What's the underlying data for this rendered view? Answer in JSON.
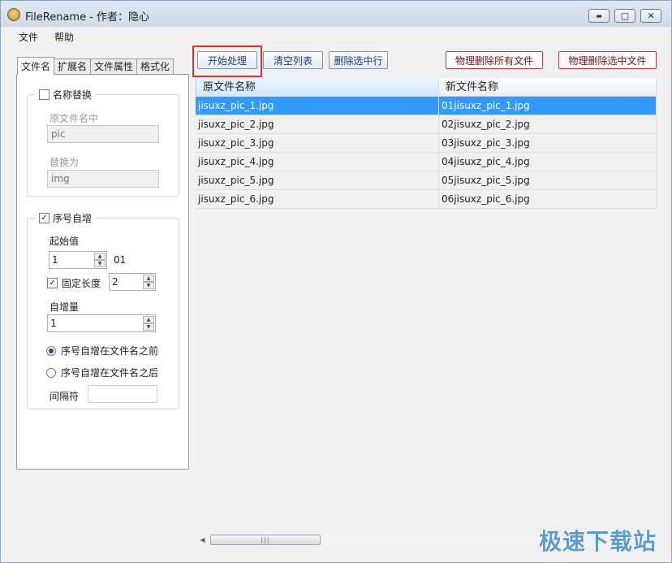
{
  "window": {
    "title": "FileRename - 作者：隐心"
  },
  "window_controls": {
    "minimize": "▬",
    "maximize": "▢",
    "close": "✕"
  },
  "menu": {
    "items": [
      "文件",
      "帮助"
    ]
  },
  "tabs": [
    "文件名",
    "扩展名",
    "文件属性",
    "格式化"
  ],
  "name_replace": {
    "label": "名称替换",
    "checked": false,
    "find_label": "原文件名中",
    "find_value": "pic",
    "replace_label": "替换为",
    "replace_value": "img"
  },
  "sequence": {
    "label": "序号自增",
    "checked": true,
    "check_mark": "✓",
    "start_label": "起始值",
    "start_value": "1",
    "preview": "01",
    "fixed_length_label": "固定长度",
    "fixed_length_checked": true,
    "fixed_length_value": "2",
    "increment_label": "自增量",
    "increment_value": "1",
    "before_label": "序号自增在文件名之前",
    "after_label": "序号自增在文件名之后",
    "position": "before",
    "separator_label": "间隔符",
    "separator_value": ""
  },
  "toolbar": {
    "start": "开始处理",
    "clear": "清空列表",
    "delete_selected_row": "删除选中行",
    "delete_all_files": "物理删除所有文件",
    "delete_selected_files": "物理删除选中文件"
  },
  "grid": {
    "columns": [
      "原文件名称",
      "新文件名称"
    ],
    "rows": [
      [
        "jisuxz_pic_1.jpg",
        "01jisuxz_pic_1.jpg"
      ],
      [
        "jisuxz_pic_2.jpg",
        "02jisuxz_pic_2.jpg"
      ],
      [
        "jisuxz_pic_3.jpg",
        "03jisuxz_pic_3.jpg"
      ],
      [
        "jisuxz_pic_4.jpg",
        "04jisuxz_pic_4.jpg"
      ],
      [
        "jisuxz_pic_5.jpg",
        "05jisuxz_pic_5.jpg"
      ],
      [
        "jisuxz_pic_6.jpg",
        "06jisuxz_pic_6.jpg"
      ]
    ],
    "selected_row": 0
  },
  "scrollbar": {
    "thumb_grip": "|||"
  },
  "watermark": "极速下载站",
  "colors": {
    "selection": "#3399ff",
    "highlight_box": "#d9332c",
    "danger_border": "#b5413c"
  }
}
